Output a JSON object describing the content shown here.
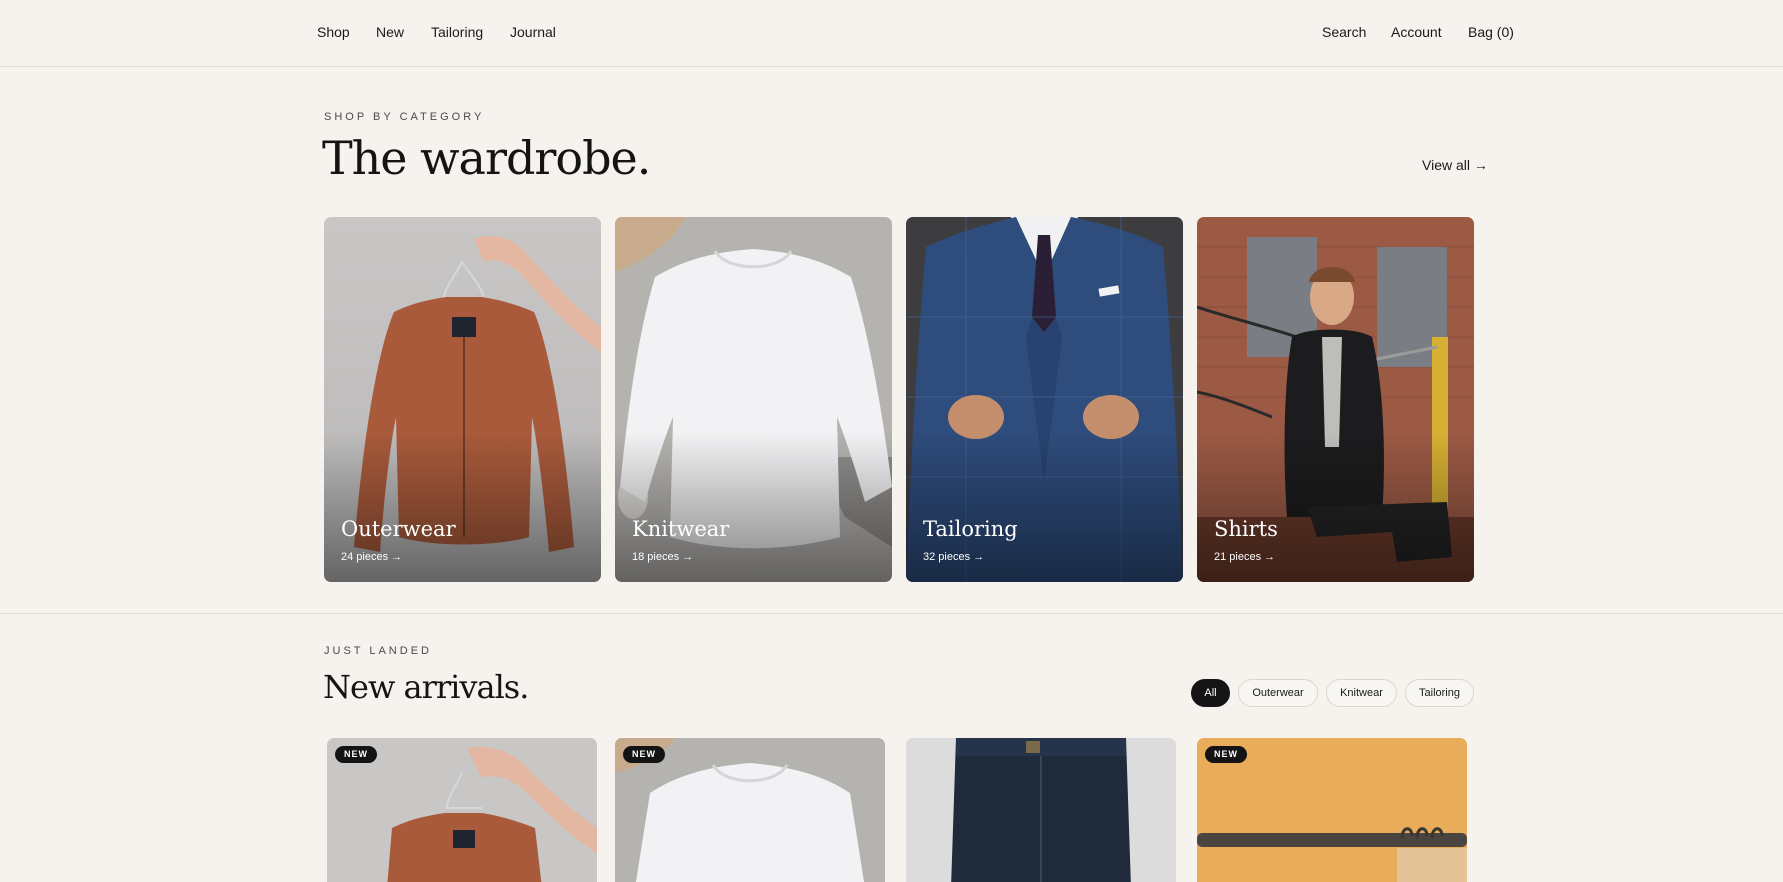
{
  "nav": {
    "left": [
      "Shop",
      "New",
      "Tailoring",
      "Journal"
    ],
    "right": [
      "Search",
      "Account",
      "Bag (0)"
    ]
  },
  "categories": {
    "eyebrow": "SHOP BY CATEGORY",
    "title": "The wardrobe.",
    "view_all": "View all →",
    "items": [
      {
        "name": "Outerwear",
        "count": "24 pieces →"
      },
      {
        "name": "Knitwear",
        "count": "18 pieces →"
      },
      {
        "name": "Tailoring",
        "count": "32 pieces →"
      },
      {
        "name": "Shirts",
        "count": "21 pieces →"
      }
    ]
  },
  "arrivals": {
    "eyebrow": "JUST LANDED",
    "title": "New arrivals.",
    "filters": [
      "All",
      "Outerwear",
      "Knitwear",
      "Tailoring"
    ],
    "active_filter": "All",
    "badge": "NEW"
  },
  "colors": {
    "background": "#f6f3ee",
    "ink": "#141414",
    "divider": "#e2ddd5"
  }
}
